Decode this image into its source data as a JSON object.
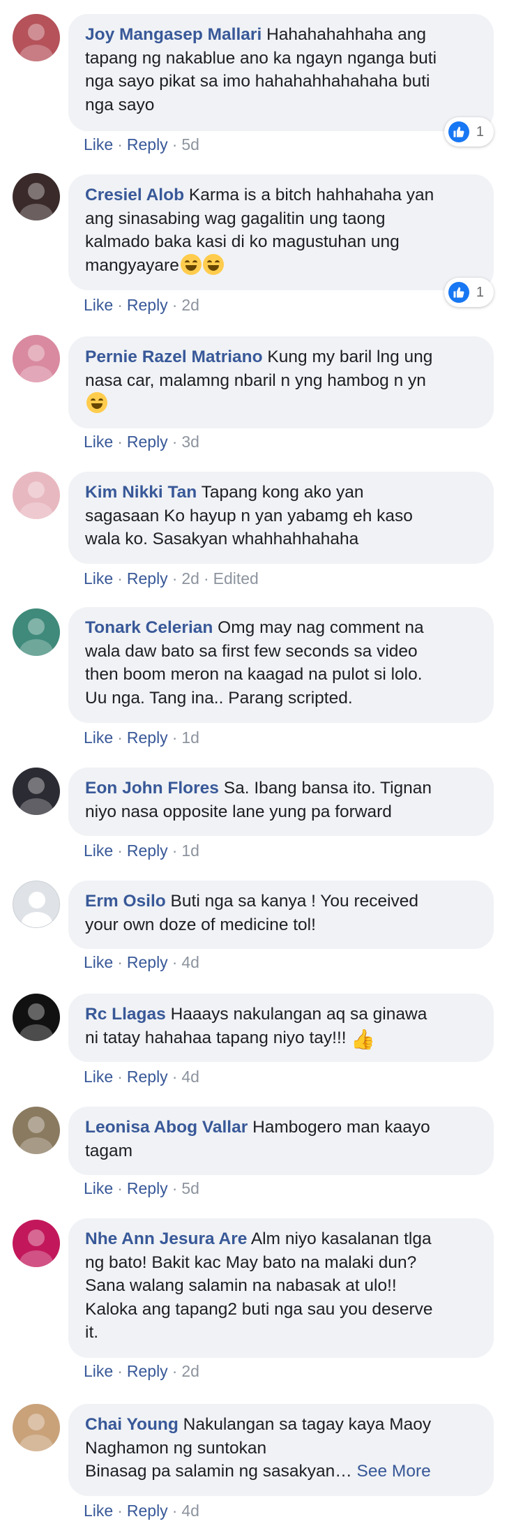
{
  "colors": {
    "author": "#385898",
    "bubble": "#f0f2f5",
    "meta_gray": "#8d949e",
    "like_blue": "#1877f2"
  },
  "actions": {
    "like": "Like",
    "reply": "Reply",
    "separator": "·",
    "see_more": "See More"
  },
  "comments": [
    {
      "author": "Joy Mangasep Mallari",
      "text": "Hahahahahhaha ang\ntapang ng nakablue ano ka ngayn nganga buti\nnga sayo pikat sa imo hahahahhahahaha buti\nnga sayo",
      "time": "5d",
      "reactions": "1",
      "avatar_color": "#b5525a"
    },
    {
      "author": "Cresiel Alob",
      "text": "Karma is a bitch hahhahaha yan\nang sinasabing wag gagalitin ung taong\nkalmado baka kasi di ko magustuhan ung\nmangyayare",
      "time": "2d",
      "reactions": "1",
      "emojis": "laugh-cry-emoji x2",
      "avatar_color": "#3a2a2a"
    },
    {
      "author": "Pernie Razel Matriano",
      "text": "Kung my baril lng ung\nnasa car, malamng nbaril n yng hambog n yn",
      "time": "3d",
      "emojis": "laugh-emoji",
      "avatar_color": "#d98aa0"
    },
    {
      "author": "Kim Nikki Tan",
      "text": "Tapang kong ako yan\nsagasaan Ko hayup n yan yabamg eh kaso\nwala ko. Sasakyan whahhahhahaha",
      "time": "2d",
      "edited": "Edited",
      "avatar_color": "#e8b8c0"
    },
    {
      "author": "Tonark Celerian",
      "text": "Omg may nag comment na\nwala daw bato sa first few seconds sa video\nthen boom meron na kaagad na pulot si lolo.\nUu nga. Tang ina.. Parang scripted.",
      "time": "1d",
      "avatar_color": "#3f8a7a"
    },
    {
      "author": "Eon John Flores",
      "text": "Sa. Ibang bansa ito. Tignan\nniyo nasa opposite lane yung pa forward",
      "time": "1d",
      "avatar_color": "#2b2b33"
    },
    {
      "author": "Erm Osilo",
      "text": "Buti nga sa kanya ! You received\nyour own doze of medicine tol!",
      "time": "4d",
      "avatar_color": "#dfe3e8"
    },
    {
      "author": "Rc Llagas",
      "text": "Haaays nakulangan aq sa ginawa\nni tatay hahahaa tapang niyo tay!!!",
      "time": "4d",
      "emojis": "thumbs-up-emoji",
      "avatar_color": "#111111"
    },
    {
      "author": "Leonisa Abog Vallar",
      "text": "Hambogero man kaayo\ntagam",
      "time": "5d",
      "avatar_color": "#8a7a60"
    },
    {
      "author": "Nhe Ann Jesura Are",
      "text": "Alm niyo kasalanan tlga\nng bato! Bakit kac May bato na malaki dun?\nSana walang salamin na nabasak at ulo!!\nKaloka ang tapang2 buti nga sau you deserve\nit.",
      "time": "2d",
      "avatar_color": "#c2185b"
    },
    {
      "author": "Chai Young",
      "text": "Nakulangan sa tagay kaya Maoy\nNaghamon ng suntokan\nBinasag pa salamin ng sasakyan…",
      "see_more": true,
      "time": "4d",
      "avatar_color": "#c9a27a"
    }
  ]
}
